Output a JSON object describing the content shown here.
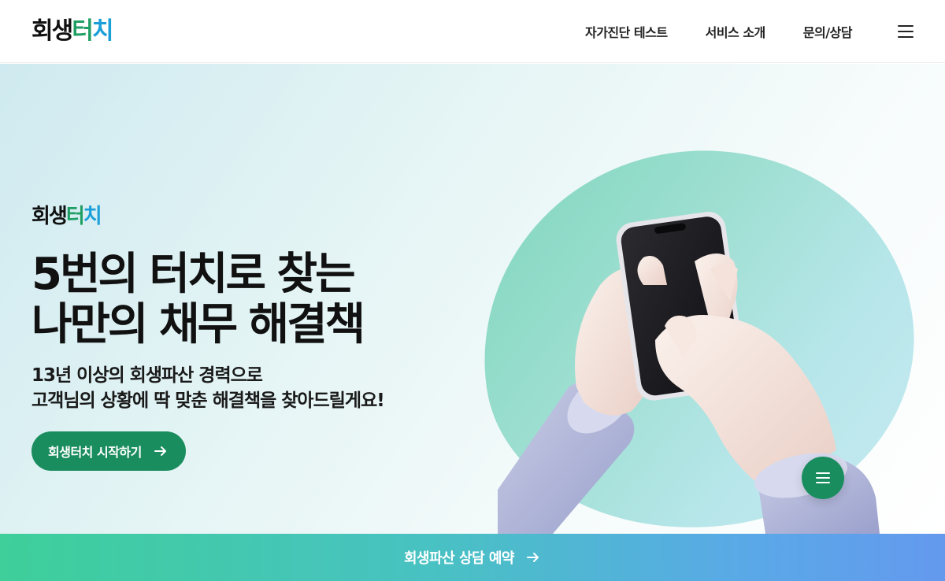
{
  "header": {
    "logo": {
      "part1": "회생",
      "part2": "터",
      "part3": "치"
    },
    "nav": [
      {
        "label": "자가진단 테스트"
      },
      {
        "label": "서비스 소개"
      },
      {
        "label": "문의/상담"
      }
    ],
    "menu_icon": "hamburger-menu-icon"
  },
  "hero": {
    "logo": {
      "part1": "회생",
      "part2": "터",
      "part3": "치"
    },
    "headline": {
      "line1": "5번의 터치로 찾는",
      "line2": "나만의 채무 해결책"
    },
    "subline": {
      "line1": "13년 이상의 회생파산 경력으로",
      "line2": "고객님의 상황에 딱 맞춘 해결책을 찾아드릴게요!"
    },
    "cta_label": "회생터치 시작하기",
    "cta_icon": "arrow-right-icon",
    "illustration": "hand-holding-phone-illustration",
    "floating_menu_icon": "hamburger-menu-icon"
  },
  "bottom_bar": {
    "label": "회생파산 상담 예약",
    "icon": "arrow-right-icon"
  },
  "colors": {
    "brand_green": "#1a8d5f",
    "logo_green": "#1f9e63",
    "logo_blue": "#1b9fd8",
    "bar_gradient_start": "#3ecf9a",
    "bar_gradient_end": "#6499ee"
  }
}
